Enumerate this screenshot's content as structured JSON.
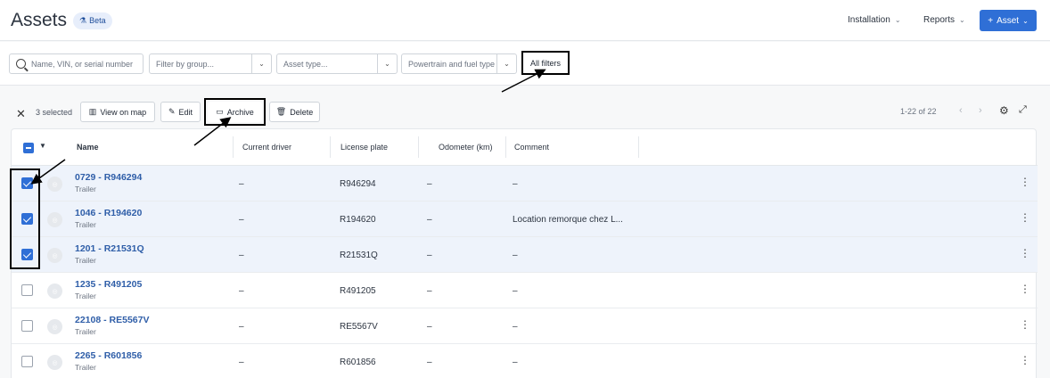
{
  "header": {
    "title": "Assets",
    "beta": "Beta",
    "installation": "Installation",
    "reports": "Reports",
    "add_asset": "Asset"
  },
  "filters": {
    "search_placeholder": "Name, VIN, or serial number",
    "group_placeholder": "Filter by group...",
    "type_placeholder": "Asset type...",
    "powertrain_placeholder": "Powertrain and fuel type",
    "all_filters": "All filters"
  },
  "actions": {
    "selected": "3 selected",
    "view_on_map": "View on map",
    "edit": "Edit",
    "archive": "Archive",
    "delete": "Delete",
    "pagination": "1-22 of 22"
  },
  "table": {
    "columns": [
      "Name",
      "Current driver",
      "License plate",
      "Odometer (km)",
      "Comment"
    ],
    "rows": [
      {
        "name": "0729 - R946294",
        "type": "Trailer",
        "driver": "–",
        "plate": "R946294",
        "odometer": "–",
        "comment": "–",
        "selected": true
      },
      {
        "name": "1046 - R194620",
        "type": "Trailer",
        "driver": "–",
        "plate": "R194620",
        "odometer": "–",
        "comment": "Location remorque chez L...",
        "selected": true
      },
      {
        "name": "1201 - R21531Q",
        "type": "Trailer",
        "driver": "–",
        "plate": "R21531Q",
        "odometer": "–",
        "comment": "–",
        "selected": true
      },
      {
        "name": "1235 - R491205",
        "type": "Trailer",
        "driver": "–",
        "plate": "R491205",
        "odometer": "–",
        "comment": "–",
        "selected": false
      },
      {
        "name": "22108 - RE5567V",
        "type": "Trailer",
        "driver": "–",
        "plate": "RE5567V",
        "odometer": "–",
        "comment": "–",
        "selected": false
      },
      {
        "name": "2265 - R601856",
        "type": "Trailer",
        "driver": "–",
        "plate": "R601856",
        "odometer": "–",
        "comment": "–",
        "selected": false
      }
    ]
  },
  "colors": {
    "accent": "#2f6fd6",
    "link": "#2f5ea8"
  },
  "icons": [
    "search-icon",
    "close-icon",
    "map-icon",
    "edit-icon",
    "archive-icon",
    "delete-icon",
    "settings-icon",
    "expand-icon",
    "more-icon"
  ]
}
